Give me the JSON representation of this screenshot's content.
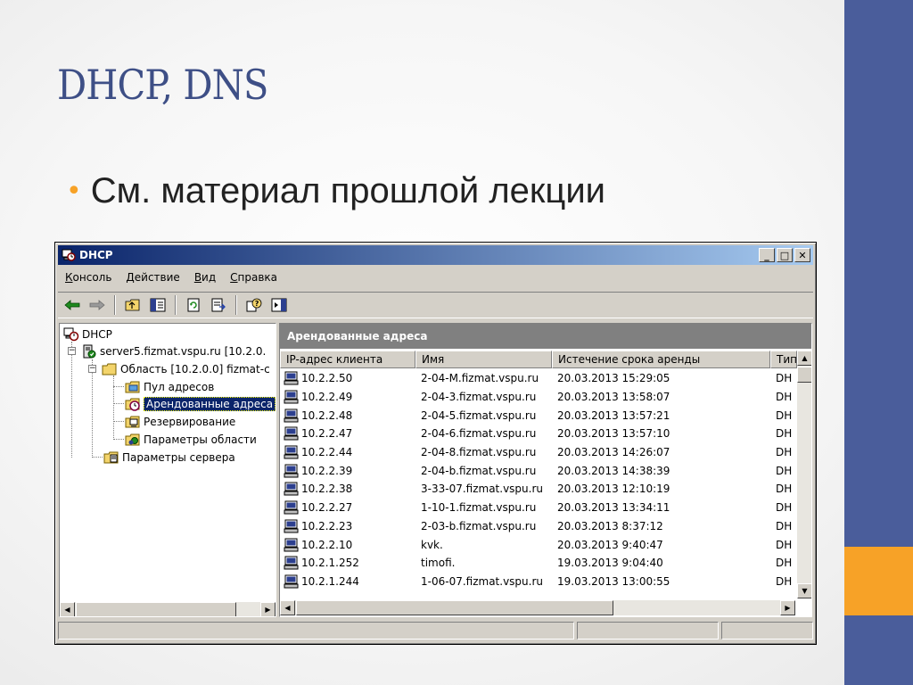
{
  "slide": {
    "title": "DHCP, DNS",
    "bullet": "См. материал прошлой лекции",
    "colors": {
      "title": "#3e4f86",
      "sidebar": "#4a5d9b",
      "accent": "#f7a227"
    }
  },
  "window": {
    "title": "DHCP",
    "buttons": {
      "minimize": "_",
      "maximize": "□",
      "close": "✕"
    }
  },
  "menubar": [
    {
      "key": "К",
      "rest": "онсоль"
    },
    {
      "key": "Д",
      "rest": "ействие"
    },
    {
      "key": "В",
      "rest": "ид"
    },
    {
      "key": "С",
      "rest": "правка"
    }
  ],
  "toolbar": {
    "icons": [
      "back-arrow-icon",
      "forward-arrow-icon",
      "up-folder-icon",
      "show-tree-icon",
      "refresh-icon",
      "export-list-icon",
      "help-icon",
      "action-pane-icon"
    ]
  },
  "tree": {
    "root": "DHCP",
    "server": "server5.fizmat.vspu.ru [10.2.0.",
    "scope": "Область [10.2.0.0] fizmat-c",
    "pool": "Пул адресов",
    "leases": "Арендованные адреса",
    "reservations": "Резервирование",
    "scope_options": "Параметры области",
    "server_options": "Параметры сервера"
  },
  "pane": {
    "header": "Арендованные адреса",
    "columns": {
      "ip": "IP-адрес клиента",
      "name": "Имя",
      "expiry": "Истечение срока аренды",
      "type": "Тип"
    },
    "rows": [
      {
        "ip": "10.2.2.50",
        "name": "2-04-M.fizmat.vspu.ru",
        "expiry": "20.03.2013 15:29:05",
        "type": "DH"
      },
      {
        "ip": "10.2.2.49",
        "name": "2-04-3.fizmat.vspu.ru",
        "expiry": "20.03.2013 13:58:07",
        "type": "DH"
      },
      {
        "ip": "10.2.2.48",
        "name": "2-04-5.fizmat.vspu.ru",
        "expiry": "20.03.2013 13:57:21",
        "type": "DH"
      },
      {
        "ip": "10.2.2.47",
        "name": "2-04-6.fizmat.vspu.ru",
        "expiry": "20.03.2013 13:57:10",
        "type": "DH"
      },
      {
        "ip": "10.2.2.44",
        "name": "2-04-8.fizmat.vspu.ru",
        "expiry": "20.03.2013 14:26:07",
        "type": "DH"
      },
      {
        "ip": "10.2.2.39",
        "name": "2-04-b.fizmat.vspu.ru",
        "expiry": "20.03.2013 14:38:39",
        "type": "DH"
      },
      {
        "ip": "10.2.2.38",
        "name": "3-33-07.fizmat.vspu.ru",
        "expiry": "20.03.2013 12:10:19",
        "type": "DH"
      },
      {
        "ip": "10.2.2.27",
        "name": "1-10-1.fizmat.vspu.ru",
        "expiry": "20.03.2013 13:34:11",
        "type": "DH"
      },
      {
        "ip": "10.2.2.23",
        "name": "2-03-b.fizmat.vspu.ru",
        "expiry": "20.03.2013 8:37:12",
        "type": "DH"
      },
      {
        "ip": "10.2.2.10",
        "name": "kvk.",
        "expiry": "20.03.2013 9:40:47",
        "type": "DH"
      },
      {
        "ip": "10.2.1.252",
        "name": "timofi.",
        "expiry": "19.03.2013 9:04:40",
        "type": "DH"
      },
      {
        "ip": "10.2.1.244",
        "name": "1-06-07.fizmat.vspu.ru",
        "expiry": "19.03.2013 13:00:55",
        "type": "DH"
      }
    ]
  }
}
